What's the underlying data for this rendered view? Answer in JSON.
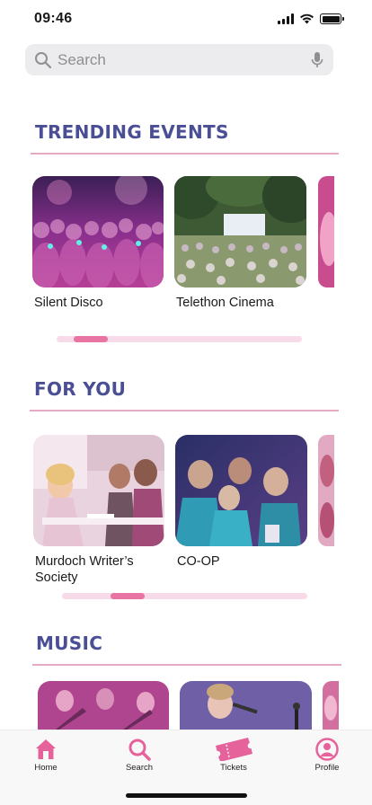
{
  "status_bar": {
    "time": "09:46"
  },
  "search": {
    "placeholder": "Search"
  },
  "sections": {
    "trending": {
      "title": "TRENDING EVENTS",
      "items": [
        {
          "label": "Silent Disco"
        },
        {
          "label": "Telethon Cinema"
        }
      ],
      "scroll_position": 0.07
    },
    "for_you": {
      "title": "FOR YOU",
      "items": [
        {
          "label": "Murdoch Writer’s Society"
        },
        {
          "label": "CO-OP"
        }
      ],
      "scroll_position": 0.2
    },
    "music": {
      "title": "MUSIC"
    }
  },
  "tab_bar": {
    "home": "Home",
    "search": "Search",
    "tickets": "Tickets",
    "profile": "Profile"
  },
  "colors": {
    "accent": "#e5629b",
    "heading": "#4a4e95",
    "divider": "#e7a9c3",
    "scroll_track": "#f8dbe8"
  }
}
